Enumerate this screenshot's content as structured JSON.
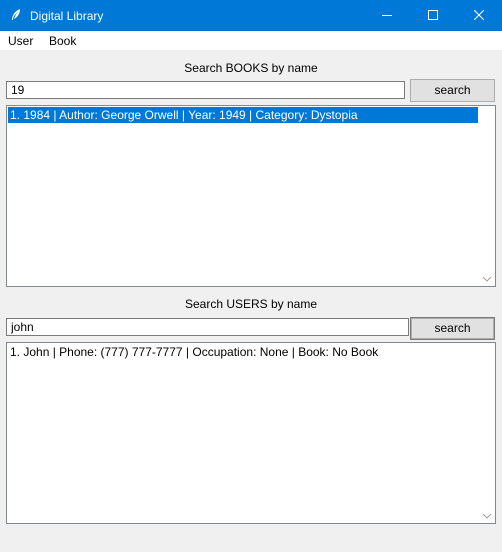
{
  "window": {
    "title": "Digital Library"
  },
  "menu": {
    "items": [
      {
        "label": "User"
      },
      {
        "label": "Book"
      }
    ]
  },
  "books": {
    "label": "Search BOOKS by name",
    "query": "19",
    "search_label": "search",
    "results": [
      {
        "text": "1. 1984 | Author: George Orwell | Year: 1949 | Category: Dystopia",
        "selected": true
      }
    ]
  },
  "users": {
    "label": "Search USERS by name",
    "query": "john",
    "search_label": "search",
    "results": [
      {
        "text": "1. John | Phone: (777) 777-7777 | Occupation: None | Book: No Book",
        "selected": false
      }
    ]
  },
  "colors": {
    "titlebar": "#0078d7",
    "selection": "#0078d7"
  }
}
